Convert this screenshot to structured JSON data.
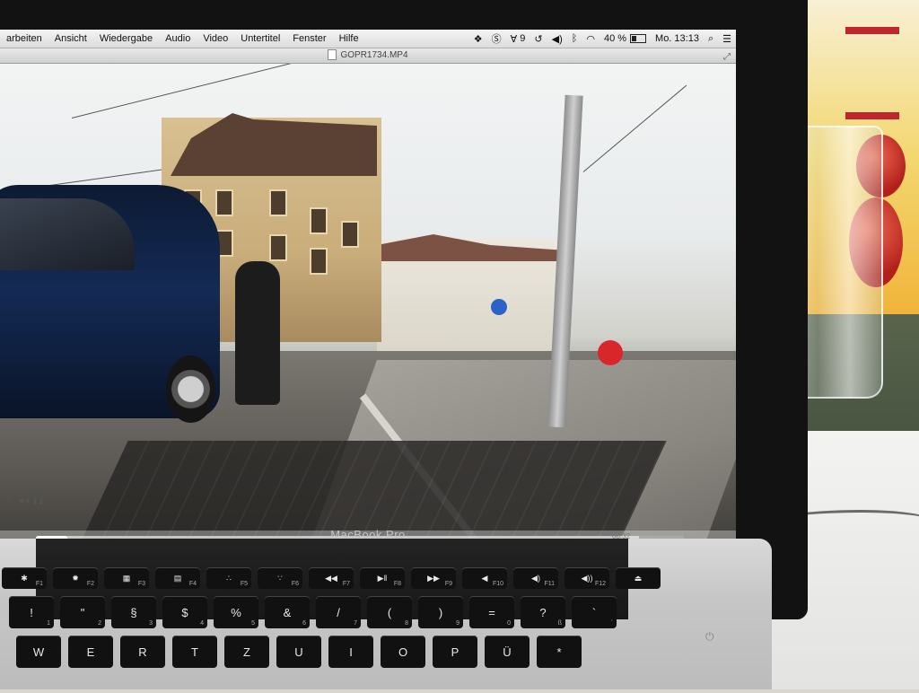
{
  "menubar": {
    "items": [
      "arbeiten",
      "Ansicht",
      "Wiedergabe",
      "Audio",
      "Video",
      "Untertitel",
      "Fenster",
      "Hilfe"
    ],
    "status": {
      "dropbox_icon": "dropbox-icon",
      "sync_icon": "shield-s-icon",
      "adobe_badge": "9",
      "battery_percent": "40 %",
      "battery_level": 0.4,
      "clock": "Mo. 13:13"
    }
  },
  "window": {
    "title": "GOPR1734.MP4"
  },
  "player": {
    "time": "00:32",
    "progress": 0.05
  },
  "laptop": {
    "brand": "MacBook Pro"
  },
  "keyboard": {
    "fn_row": [
      {
        "label": "✱",
        "sub": "F1"
      },
      {
        "label": "✹",
        "sub": "F2"
      },
      {
        "label": "▦",
        "sub": "F3"
      },
      {
        "label": "▤",
        "sub": "F4"
      },
      {
        "label": "∴",
        "sub": "F5"
      },
      {
        "label": "∵",
        "sub": "F6"
      },
      {
        "label": "◀◀",
        "sub": "F7"
      },
      {
        "label": "▶ǁ",
        "sub": "F8"
      },
      {
        "label": "▶▶",
        "sub": "F9"
      },
      {
        "label": "◀",
        "sub": "F10"
      },
      {
        "label": "◀)",
        "sub": "F11"
      },
      {
        "label": "◀))",
        "sub": "F12"
      },
      {
        "label": "⏏",
        "sub": ""
      }
    ],
    "num_row": [
      {
        "label": "!",
        "sub": "1"
      },
      {
        "label": "\"",
        "sub": "2"
      },
      {
        "label": "§",
        "sub": "3"
      },
      {
        "label": "$",
        "sub": "4"
      },
      {
        "label": "%",
        "sub": "5"
      },
      {
        "label": "&",
        "sub": "6"
      },
      {
        "label": "/",
        "sub": "7"
      },
      {
        "label": "(",
        "sub": "8"
      },
      {
        "label": ")",
        "sub": "9"
      },
      {
        "label": "=",
        "sub": "0"
      },
      {
        "label": "?",
        "sub": "ß"
      },
      {
        "label": "`",
        "sub": "´"
      }
    ],
    "letter_row": [
      "W",
      "E",
      "R",
      "T",
      "Z",
      "U",
      "I",
      "O",
      "P",
      "Ü",
      "*"
    ]
  }
}
